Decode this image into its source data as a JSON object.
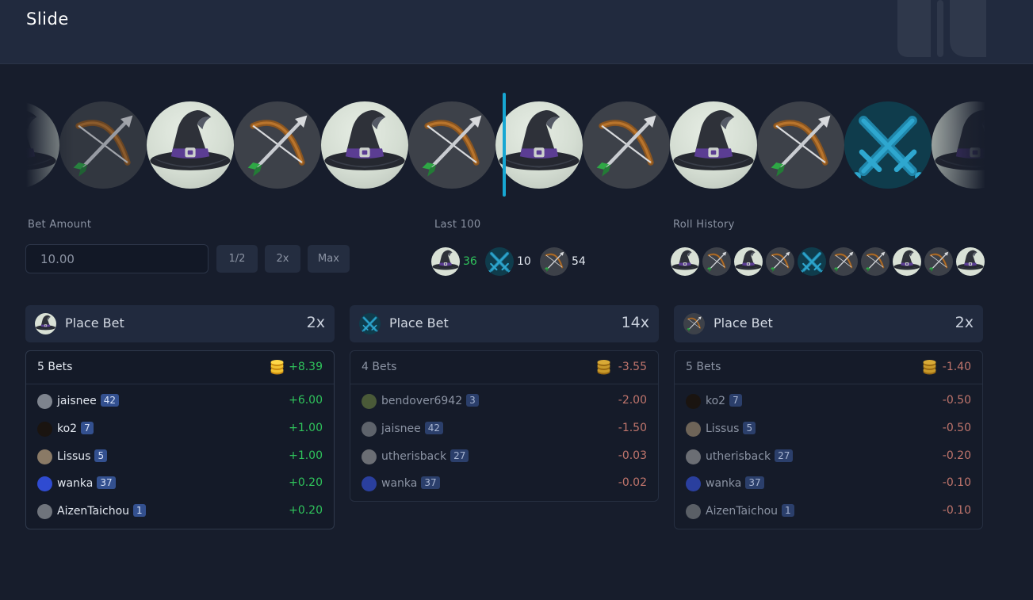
{
  "header": {
    "title": "Slide"
  },
  "slider": {
    "tiles": [
      "hat",
      "bow",
      "hat",
      "bow",
      "hat",
      "bow",
      "hat",
      "bow",
      "hat",
      "bow",
      "sword",
      "hat"
    ]
  },
  "bet_amount": {
    "label": "Bet Amount",
    "value": "10.00",
    "buttons": [
      "1/2",
      "2x",
      "Max"
    ]
  },
  "last100": {
    "label": "Last 100",
    "hat_count": "36",
    "sword_count": "10",
    "bow_count": "54"
  },
  "roll_history": {
    "label": "Roll History",
    "items": [
      "hat",
      "bow",
      "hat",
      "bow",
      "sword",
      "bow",
      "bow",
      "hat",
      "bow",
      "hat"
    ]
  },
  "panels": [
    {
      "icon": "hat",
      "title": "Place Bet",
      "multiplier": "2x",
      "bets_label": "5 Bets",
      "total": "+8.39",
      "rows": [
        {
          "name": "jaisnee",
          "level": "42",
          "amount": "+6.00"
        },
        {
          "name": "ko2",
          "level": "7",
          "amount": "+1.00"
        },
        {
          "name": "Lissus",
          "level": "5",
          "amount": "+1.00"
        },
        {
          "name": "wanka",
          "level": "37",
          "amount": "+0.20"
        },
        {
          "name": "AizenTaichou",
          "level": "1",
          "amount": "+0.20"
        }
      ]
    },
    {
      "icon": "sword",
      "title": "Place Bet",
      "multiplier": "14x",
      "bets_label": "4 Bets",
      "total": "-3.55",
      "rows": [
        {
          "name": "bendover6942",
          "level": "3",
          "amount": "-2.00"
        },
        {
          "name": "jaisnee",
          "level": "42",
          "amount": "-1.50"
        },
        {
          "name": "utherisback",
          "level": "27",
          "amount": "-0.03"
        },
        {
          "name": "wanka",
          "level": "37",
          "amount": "-0.02"
        }
      ]
    },
    {
      "icon": "bow",
      "title": "Place Bet",
      "multiplier": "2x",
      "bets_label": "5 Bets",
      "total": "-1.40",
      "rows": [
        {
          "name": "ko2",
          "level": "7",
          "amount": "-0.50"
        },
        {
          "name": "Lissus",
          "level": "5",
          "amount": "-0.50"
        },
        {
          "name": "utherisback",
          "level": "27",
          "amount": "-0.20"
        },
        {
          "name": "wanka",
          "level": "37",
          "amount": "-0.10"
        },
        {
          "name": "AizenTaichou",
          "level": "1",
          "amount": "-0.10"
        }
      ]
    }
  ],
  "colors": {
    "background": "#171d2c",
    "header": "#212a3e",
    "accent": "#17a7d3",
    "positive": "#2fc25b",
    "negative": "#c0756c",
    "level_badge": "#33508f"
  }
}
